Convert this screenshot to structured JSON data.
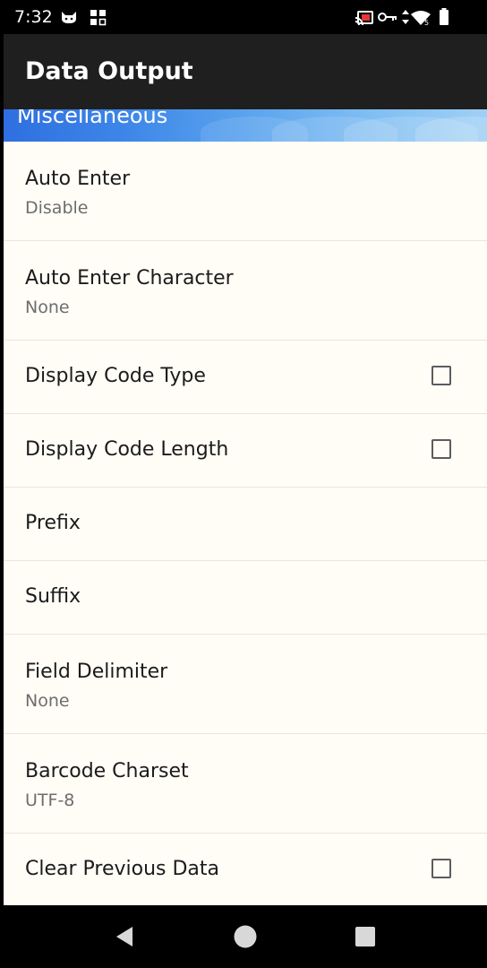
{
  "status_bar": {
    "time": "7:32",
    "icons": [
      "cat-notification-icon",
      "apps-grid-icon",
      "cast-icon",
      "vpn-key-icon",
      "data-arrows-icon",
      "wifi-icon",
      "battery-icon"
    ]
  },
  "app_bar": {
    "title": "Data Output"
  },
  "category": {
    "title": "Miscellaneous"
  },
  "preferences": [
    {
      "title": "Auto Enter",
      "summary": "Disable",
      "checkbox": false
    },
    {
      "title": "Auto Enter Character",
      "summary": "None",
      "checkbox": false
    },
    {
      "title": "Display Code Type",
      "checkbox": true,
      "checked": false
    },
    {
      "title": "Display Code Length",
      "checkbox": true,
      "checked": false
    },
    {
      "title": "Prefix"
    },
    {
      "title": "Suffix"
    },
    {
      "title": "Field Delimiter",
      "summary": "None"
    },
    {
      "title": "Barcode Charset",
      "summary": "UTF-8"
    },
    {
      "title": "Clear Previous Data",
      "checkbox": true,
      "checked": false
    }
  ],
  "nav_bar": {
    "buttons": [
      "back-icon",
      "home-icon",
      "recents-icon"
    ]
  },
  "colors": {
    "status_bar": "#000000",
    "app_bar": "#1f1f1f",
    "list_background": "#fffdf6",
    "accent_blue": "#2f6fe0"
  }
}
